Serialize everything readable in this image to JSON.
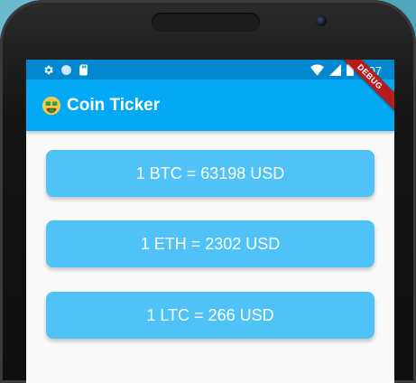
{
  "status_bar": {
    "time": "3:07",
    "left_icons": [
      "gear-icon",
      "circle-icon",
      "sd-card-icon"
    ],
    "right_icons": [
      "wifi-icon",
      "signal-icon",
      "battery-icon"
    ],
    "color": "#0288d1"
  },
  "app_bar": {
    "icon": "money-face-emoji-icon",
    "title": "Coin Ticker",
    "color": "#03a9f4"
  },
  "debug_banner": {
    "label": "DEBUG",
    "color": "#b71c1c"
  },
  "rates": [
    {
      "text": "1 BTC = 63198 USD"
    },
    {
      "text": "1 ETH = 2302 USD"
    },
    {
      "text": "1 LTC = 266 USD"
    }
  ],
  "card_color": "#4fc3f7"
}
